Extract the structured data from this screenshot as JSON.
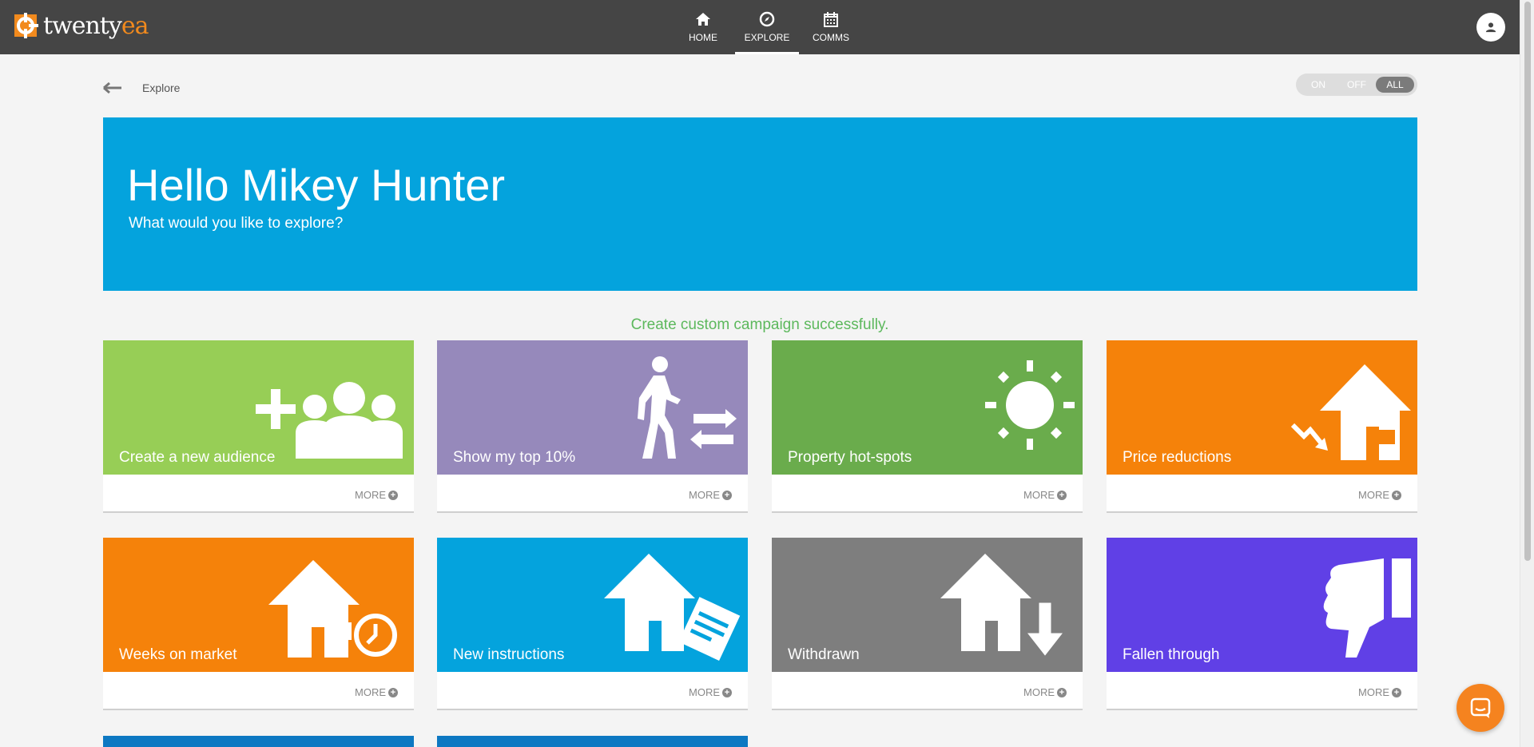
{
  "header": {
    "logo_text": "twenty",
    "logo_text_accent": "ea",
    "nav": [
      {
        "label": "HOME",
        "icon": "home-icon"
      },
      {
        "label": "EXPLORE",
        "icon": "compass-icon"
      },
      {
        "label": "COMMS",
        "icon": "calendar-icon"
      }
    ],
    "active_nav": "EXPLORE",
    "user_icon": "user-icon"
  },
  "breadcrumb": {
    "label": "Explore"
  },
  "toggle": {
    "options": [
      "ON",
      "OFF",
      "ALL"
    ],
    "selected": "ALL"
  },
  "hero": {
    "title": "Hello Mikey Hunter",
    "subtitle": "What would you like to explore?",
    "color": "#04a3dd"
  },
  "status_message": "Create custom campaign successfully.",
  "tiles": [
    {
      "label": "Create a new audience",
      "more": "MORE",
      "color": "#97ce56",
      "icon": "add-group-icon"
    },
    {
      "label": "Show my top 10%",
      "more": "MORE",
      "color": "#9689bb",
      "icon": "walker-arrows-icon"
    },
    {
      "label": "Property hot-spots",
      "more": "MORE",
      "color": "#6aac4c",
      "icon": "sun-icon"
    },
    {
      "label": "Price reductions",
      "more": "MORE",
      "color": "#f5820a",
      "icon": "house-price-down-icon"
    },
    {
      "label": "Weeks on market",
      "more": "MORE",
      "color": "#f5820a",
      "icon": "house-clock-icon"
    },
    {
      "label": "New instructions",
      "more": "MORE",
      "color": "#04a3dd",
      "icon": "house-document-icon"
    },
    {
      "label": "Withdrawn",
      "more": "MORE",
      "color": "#7e7e7e",
      "icon": "house-down-arrow-icon"
    },
    {
      "label": "Fallen through",
      "more": "MORE",
      "color": "#6040e6",
      "icon": "thumbs-down-icon"
    }
  ],
  "partial_tiles_color": "#0d78c2",
  "chat_button": {
    "icon": "chat-icon",
    "color": "#f5831f"
  }
}
